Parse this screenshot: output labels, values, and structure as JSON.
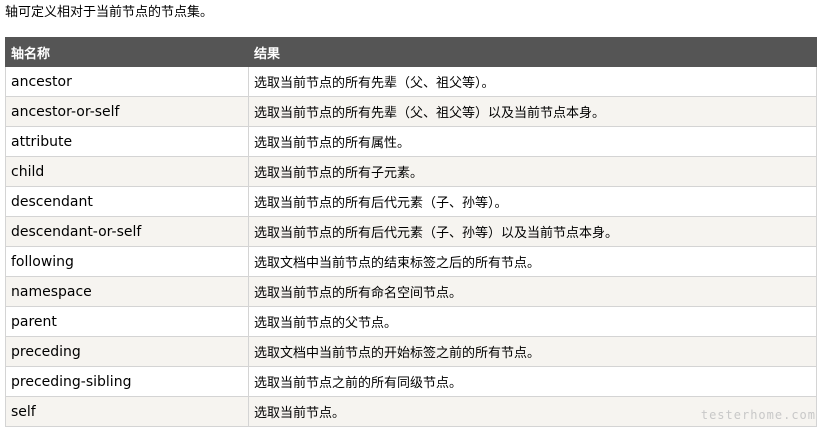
{
  "intro": "轴可定义相对于当前节点的节点集。",
  "table": {
    "headers": [
      "轴名称",
      "结果"
    ],
    "rows": [
      {
        "name": "ancestor",
        "desc": "选取当前节点的所有先辈（父、祖父等）。"
      },
      {
        "name": "ancestor-or-self",
        "desc": "选取当前节点的所有先辈（父、祖父等）以及当前节点本身。"
      },
      {
        "name": "attribute",
        "desc": "选取当前节点的所有属性。"
      },
      {
        "name": "child",
        "desc": "选取当前节点的所有子元素。"
      },
      {
        "name": "descendant",
        "desc": "选取当前节点的所有后代元素（子、孙等）。"
      },
      {
        "name": "descendant-or-self",
        "desc": "选取当前节点的所有后代元素（子、孙等）以及当前节点本身。"
      },
      {
        "name": "following",
        "desc": "选取文档中当前节点的结束标签之后的所有节点。"
      },
      {
        "name": "namespace",
        "desc": "选取当前节点的所有命名空间节点。"
      },
      {
        "name": "parent",
        "desc": "选取当前节点的父节点。"
      },
      {
        "name": "preceding",
        "desc": "选取文档中当前节点的开始标签之前的所有节点。"
      },
      {
        "name": "preceding-sibling",
        "desc": "选取当前节点之前的所有同级节点。"
      },
      {
        "name": "self",
        "desc": "选取当前节点。"
      }
    ]
  },
  "watermark": "testerhome.com"
}
